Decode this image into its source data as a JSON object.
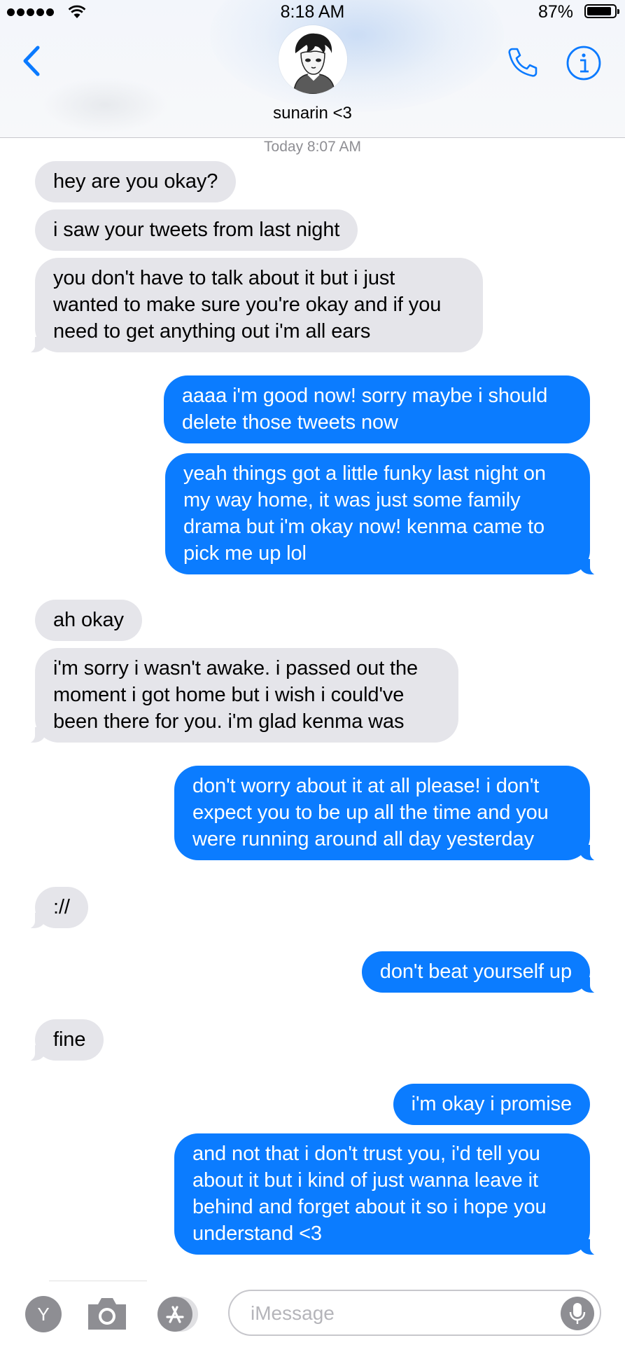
{
  "status_bar": {
    "time": "8:18 AM",
    "battery": "87%",
    "signal_icon": "signal-dots-icon",
    "wifi_icon": "wifi-icon",
    "battery_icon": "battery-icon"
  },
  "header": {
    "back_icon": "chevron-left-icon",
    "contact_name": "sunarin <3",
    "avatar_icon": "contact-avatar",
    "phone_icon": "phone-icon",
    "info_icon": "info-icon"
  },
  "conversation": {
    "timestamp": "Today 8:07 AM",
    "messages": [
      {
        "from": "them",
        "text": "hey are you okay?"
      },
      {
        "from": "them",
        "text": "i saw your tweets from last night"
      },
      {
        "from": "them",
        "text": "you don't have to talk about it but i just wanted to make sure you're okay and if you need to get anything out i'm all ears"
      },
      {
        "from": "me",
        "text": "aaaa i'm good now! sorry maybe i should delete those tweets now"
      },
      {
        "from": "me",
        "text": "yeah things got a little funky last night on my way home, it was just some family drama but i'm okay now! kenma came to pick me up lol"
      },
      {
        "from": "them",
        "text": "ah okay"
      },
      {
        "from": "them",
        "text": "i'm sorry i wasn't awake. i passed out the moment i got home but i wish i could've been there for you. i'm glad kenma was"
      },
      {
        "from": "me",
        "text": "don't worry about it at all please! i don't expect you to be up all the time and you were running around all day yesterday"
      },
      {
        "from": "them",
        "text": "://"
      },
      {
        "from": "me",
        "text": "don't beat yourself up"
      },
      {
        "from": "them",
        "text": "fine"
      },
      {
        "from": "me",
        "text": "i'm okay i promise"
      },
      {
        "from": "me",
        "text": "and not that i don't trust you, i'd tell you about it but i kind of just wanna leave it behind and forget about it so i hope you understand <3"
      }
    ]
  },
  "input_bar": {
    "app_letter": "Y",
    "camera_icon": "camera-icon",
    "appstore_icon": "app-store-icon",
    "placeholder": "iMessage",
    "value": "",
    "mic_icon": "microphone-icon"
  },
  "colors": {
    "sent_bubble": "#0b7cff",
    "received_bubble": "#e5e5ea",
    "accent": "#0a7aff",
    "timestamp": "#8e8e93"
  }
}
